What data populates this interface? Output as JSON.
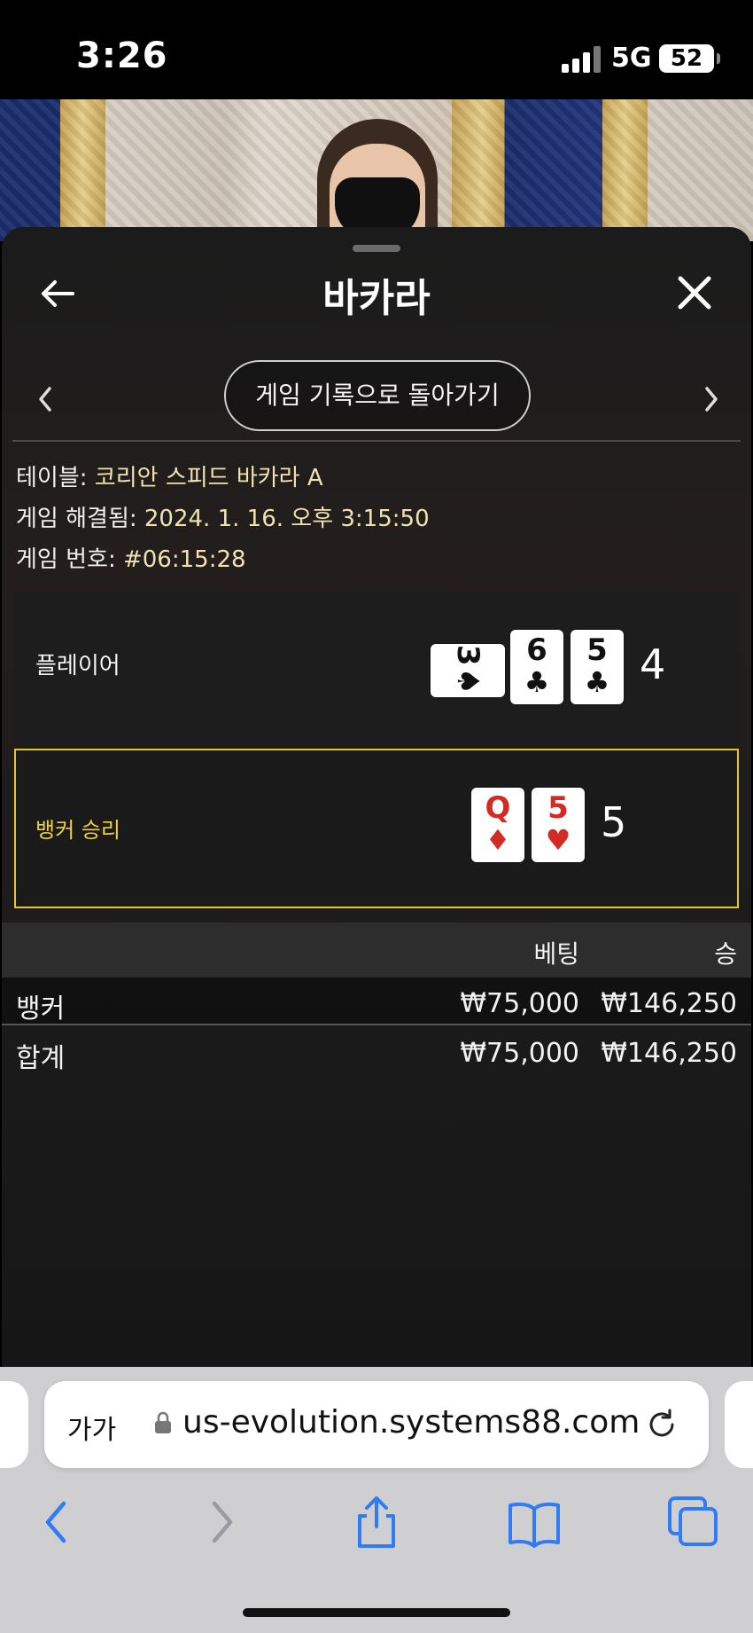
{
  "status_bar": {
    "time": "3:26",
    "network": "5G",
    "battery": "52"
  },
  "sheet": {
    "title": "바카라",
    "history_button": "게임 기록으로 돌아가기"
  },
  "info": {
    "table_label": "테이블:",
    "table_value": "코리안 스피드 바카라 A",
    "resolved_label": "게임 해결됨:",
    "resolved_value": "2024. 1. 16. 오후 3:15:50",
    "number_label": "게임 번호:",
    "number_value": "#06:15:28"
  },
  "hands": {
    "player": {
      "label": "플레이어",
      "score": "4",
      "cards": [
        {
          "rank": "3",
          "suit": "♠",
          "color": "black",
          "orientation": "sideways"
        },
        {
          "rank": "6",
          "suit": "♣",
          "color": "black"
        },
        {
          "rank": "5",
          "suit": "♣",
          "color": "black"
        }
      ]
    },
    "banker": {
      "label": "뱅커 승리",
      "score": "5",
      "cards": [
        {
          "rank": "Q",
          "suit": "♦",
          "color": "red"
        },
        {
          "rank": "5",
          "suit": "♥",
          "color": "red"
        }
      ]
    }
  },
  "results": {
    "header": {
      "bet": "베팅",
      "win": "승"
    },
    "rows": [
      {
        "name": "뱅커",
        "bet": "₩75,000",
        "win": "₩146,250"
      },
      {
        "name": "합계",
        "bet": "₩75,000",
        "win": "₩146,250"
      }
    ]
  },
  "browser": {
    "text_size_label": "가가",
    "url": "us-evolution.systems88.com"
  },
  "colors": {
    "highlight_border": "#e7c62d",
    "info_value": "#f0e2b0",
    "link_blue": "#2f7cf6"
  }
}
